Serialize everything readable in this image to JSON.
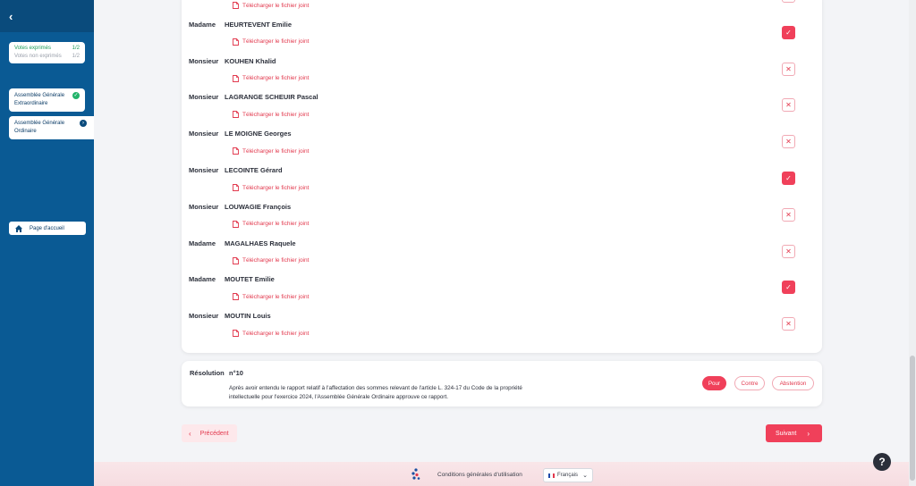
{
  "sidebar": {
    "votes": {
      "exprimes_label": "Votes exprimés",
      "exprimes_count": "1/2",
      "non_exprimes_label": "Votes non exprimés",
      "non_exprimes_count": "1/2"
    },
    "ag_extra": {
      "line1": "Assemblée Générale",
      "line2": "Extraordinaire",
      "status": "completed"
    },
    "ag_ord": {
      "line1": "Assemblée Générale",
      "line2": "Ordinaire",
      "status": "current"
    },
    "home_label": "Page d'accueil"
  },
  "download_label": "Télécharger le fichier joint",
  "persons": [
    {
      "title": "",
      "name": "",
      "vote": "off"
    },
    {
      "title": "Madame",
      "name": "HEURTEVENT Emilie",
      "vote": "on"
    },
    {
      "title": "Monsieur",
      "name": "KOUHEN Khalid",
      "vote": "off"
    },
    {
      "title": "Monsieur",
      "name": "LAGRANGE SCHEUIR Pascal",
      "vote": "off"
    },
    {
      "title": "Monsieur",
      "name": "LE MOIGNE Georges",
      "vote": "off"
    },
    {
      "title": "Monsieur",
      "name": "LECOINTE Gérard",
      "vote": "on"
    },
    {
      "title": "Monsieur",
      "name": "LOUWAGIE François",
      "vote": "off"
    },
    {
      "title": "Madame",
      "name": "MAGALHAES Raquele",
      "vote": "off"
    },
    {
      "title": "Madame",
      "name": "MOUTET Emilie",
      "vote": "on"
    },
    {
      "title": "Monsieur",
      "name": "MOUTIN Louis",
      "vote": "off"
    }
  ],
  "resolution": {
    "label": "Résolution",
    "number": "n°10",
    "text": "Après avoir entendu le rapport relatif à l'affectation des sommes relevant de l'article L. 324-17 du Code de la propriété intellectuelle pour l'exercice 2024, l'Assemblée Générale Ordinaire approuve ce rapport.",
    "options": {
      "pour": "Pour",
      "contre": "Contre",
      "abstention": "Abstention"
    },
    "selected": "pour"
  },
  "nav": {
    "prev": "Précédent",
    "next": "Suivant"
  },
  "help": "?",
  "footer": {
    "terms": "Conditions générales d'utilisation",
    "language": "Français"
  },
  "colors": {
    "accent": "#f0405a",
    "sidebar": "#0a5a94",
    "success": "#22b36a"
  }
}
